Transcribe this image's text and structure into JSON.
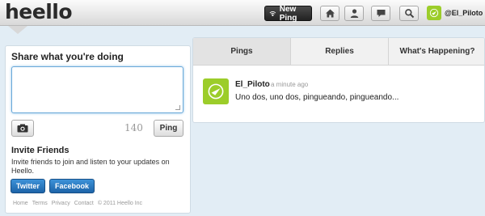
{
  "app": {
    "logo": "heello"
  },
  "topbar": {
    "new_ping_label": "New Ping",
    "nav_icons": [
      "home-icon",
      "profile-icon",
      "messages-icon",
      "search-icon"
    ],
    "user_name": "@El_Piloto"
  },
  "composer": {
    "title": "Share what you're doing",
    "input_value": "",
    "char_count": "140",
    "ping_button": "Ping"
  },
  "invite": {
    "title": "Invite Friends",
    "description": "Invite friends to join and listen to your updates on Heello.",
    "buttons": [
      "Twitter",
      "Facebook"
    ]
  },
  "footer": {
    "links": [
      "Home",
      "Terms",
      "Privacy",
      "Contact"
    ],
    "copyright": "© 2011 Heello Inc"
  },
  "feed": {
    "tabs": [
      "Pings",
      "Replies",
      "What's Happening?"
    ],
    "active_tab": "Pings",
    "items": [
      {
        "user": "El_Piloto",
        "time": "a minute ago",
        "text": "Uno dos, uno dos, pingueando, pingueando..."
      }
    ]
  },
  "colors": {
    "accent": "#9ccd2a",
    "button_blue": "#1d64a8",
    "background": "#e2edf5"
  }
}
